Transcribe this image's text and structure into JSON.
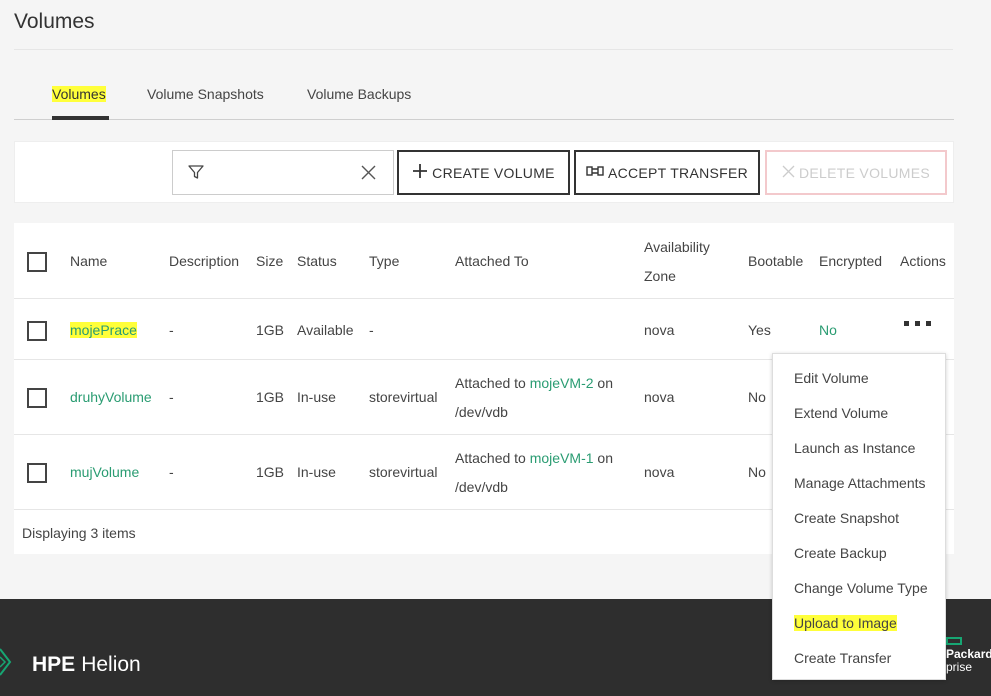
{
  "page": {
    "title": "Volumes"
  },
  "tabs": [
    {
      "label": "Volumes"
    },
    {
      "label": "Volume Snapshots"
    },
    {
      "label": "Volume Backups"
    }
  ],
  "toolbar": {
    "filter_placeholder": "",
    "create_label": "CREATE VOLUME",
    "accept_label": "ACCEPT TRANSFER",
    "delete_label": "DELETE VOLUMES"
  },
  "table": {
    "headers": {
      "name": "Name",
      "description": "Description",
      "size": "Size",
      "status": "Status",
      "type": "Type",
      "attached_to": "Attached To",
      "availability_zone_1": "Availability",
      "availability_zone_2": "Zone",
      "bootable": "Bootable",
      "encrypted": "Encrypted",
      "actions": "Actions"
    },
    "rows": [
      {
        "name": "mojePrace",
        "description": "-",
        "size": "1GB",
        "status": "Available",
        "type": "-",
        "attached_prefix": "",
        "attached_vm": "",
        "attached_suffix": "",
        "attached_dev": "",
        "zone": "nova",
        "bootable": "Yes",
        "encrypted": "No"
      },
      {
        "name": "druhyVolume",
        "description": "-",
        "size": "1GB",
        "status": "In-use",
        "type": "storevirtual",
        "attached_prefix": "Attached to ",
        "attached_vm": "mojeVM-2",
        "attached_suffix": " on",
        "attached_dev": "/dev/vdb",
        "zone": "nova",
        "bootable": "No",
        "encrypted": ""
      },
      {
        "name": "mujVolume",
        "description": "-",
        "size": "1GB",
        "status": "In-use",
        "type": "storevirtual",
        "attached_prefix": "Attached to ",
        "attached_vm": "mojeVM-1",
        "attached_suffix": " on",
        "attached_dev": "/dev/vdb",
        "zone": "nova",
        "bootable": "No",
        "encrypted": ""
      }
    ],
    "footer": "Displaying 3 items"
  },
  "actions_menu": [
    "Edit Volume",
    "Extend Volume",
    "Launch as Instance",
    "Manage Attachments",
    "Create Snapshot",
    "Create Backup",
    "Change Volume Type",
    "Upload to Image",
    "Create Transfer"
  ],
  "footer": {
    "brand_bold": "HPE",
    "brand_name": "Helion",
    "right_line1": "Packard",
    "right_line2": "prise"
  },
  "colors": {
    "link": "#2a9c72",
    "highlight": "#ffff3a",
    "footer_bg": "#2e2e2e",
    "brand_green": "#17a673"
  },
  "icons": [
    "filter-icon",
    "clear-icon",
    "plus-icon",
    "transfer-icon",
    "close-icon",
    "kebab-icon",
    "hpe-logo-icon"
  ]
}
